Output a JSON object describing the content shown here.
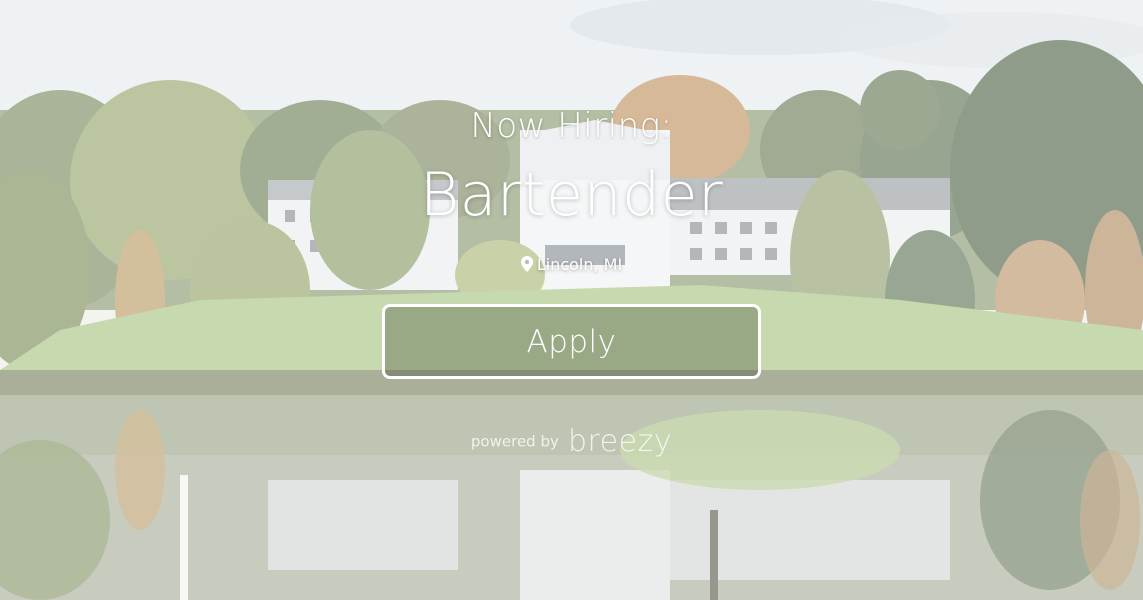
{
  "hero": {
    "eyebrow": "Now Hiring:",
    "job_title": "Bartender",
    "location": "Lincoln, MI",
    "location_icon": "map-pin-icon",
    "apply_label": "Apply"
  },
  "footer": {
    "powered_by": "powered by",
    "brand": "breezy"
  },
  "colors": {
    "text": "#ffffff",
    "button_border": "#ffffff",
    "sky": "#dfe5ea",
    "grass": "#a8c484",
    "water": "#b9c4bd"
  }
}
